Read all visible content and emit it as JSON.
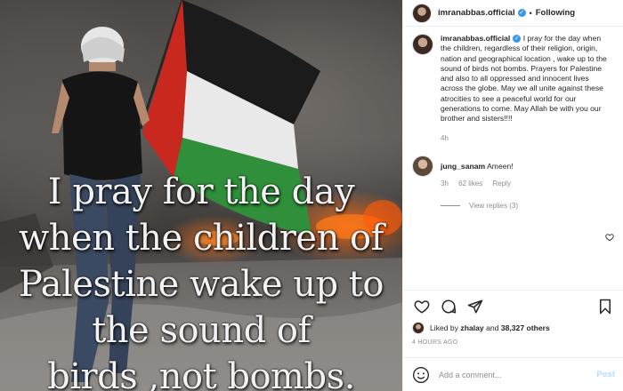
{
  "photo": {
    "overlay_lines": [
      "I pray for the day",
      "when the children of",
      "Palestine wake up to",
      "the sound of",
      "birds ,not bombs."
    ]
  },
  "header": {
    "username": "imranabbas.official",
    "separator": "•",
    "follow_status": "Following",
    "verified_mark": "✓",
    "more_icon": "more-horizontal-icon"
  },
  "caption": {
    "username": "imranabbas.official",
    "text": " I pray for the day when the children, regardless of their religion, origin, nation and geographical location , wake up to the sound of birds not bombs. Prayers for Palestine and also to all oppressed and innocent lives across the globe. May we all unite against these atrocities to see a peaceful world for our generations to come. May Allah be with you our brother and sisters!!!!",
    "time": "4h"
  },
  "reply": {
    "username": "jung_sanam",
    "text": " Ameen!",
    "time": "3h",
    "likes": "62 likes",
    "reply_label": "Reply",
    "view_replies": "View replies (3)"
  },
  "post": {
    "liked_prefix": "Liked by ",
    "liked_user": "zhalay",
    "liked_mid": " and ",
    "liked_count": "38,327 others",
    "time_ago": "4 HOURS AGO"
  },
  "comment_box": {
    "placeholder": "Add a comment...",
    "post_label": "Post"
  },
  "colors": {
    "verified_blue": "#3897f0",
    "post_disabled": "#b3dbff",
    "muted": "#8e8e8e"
  }
}
